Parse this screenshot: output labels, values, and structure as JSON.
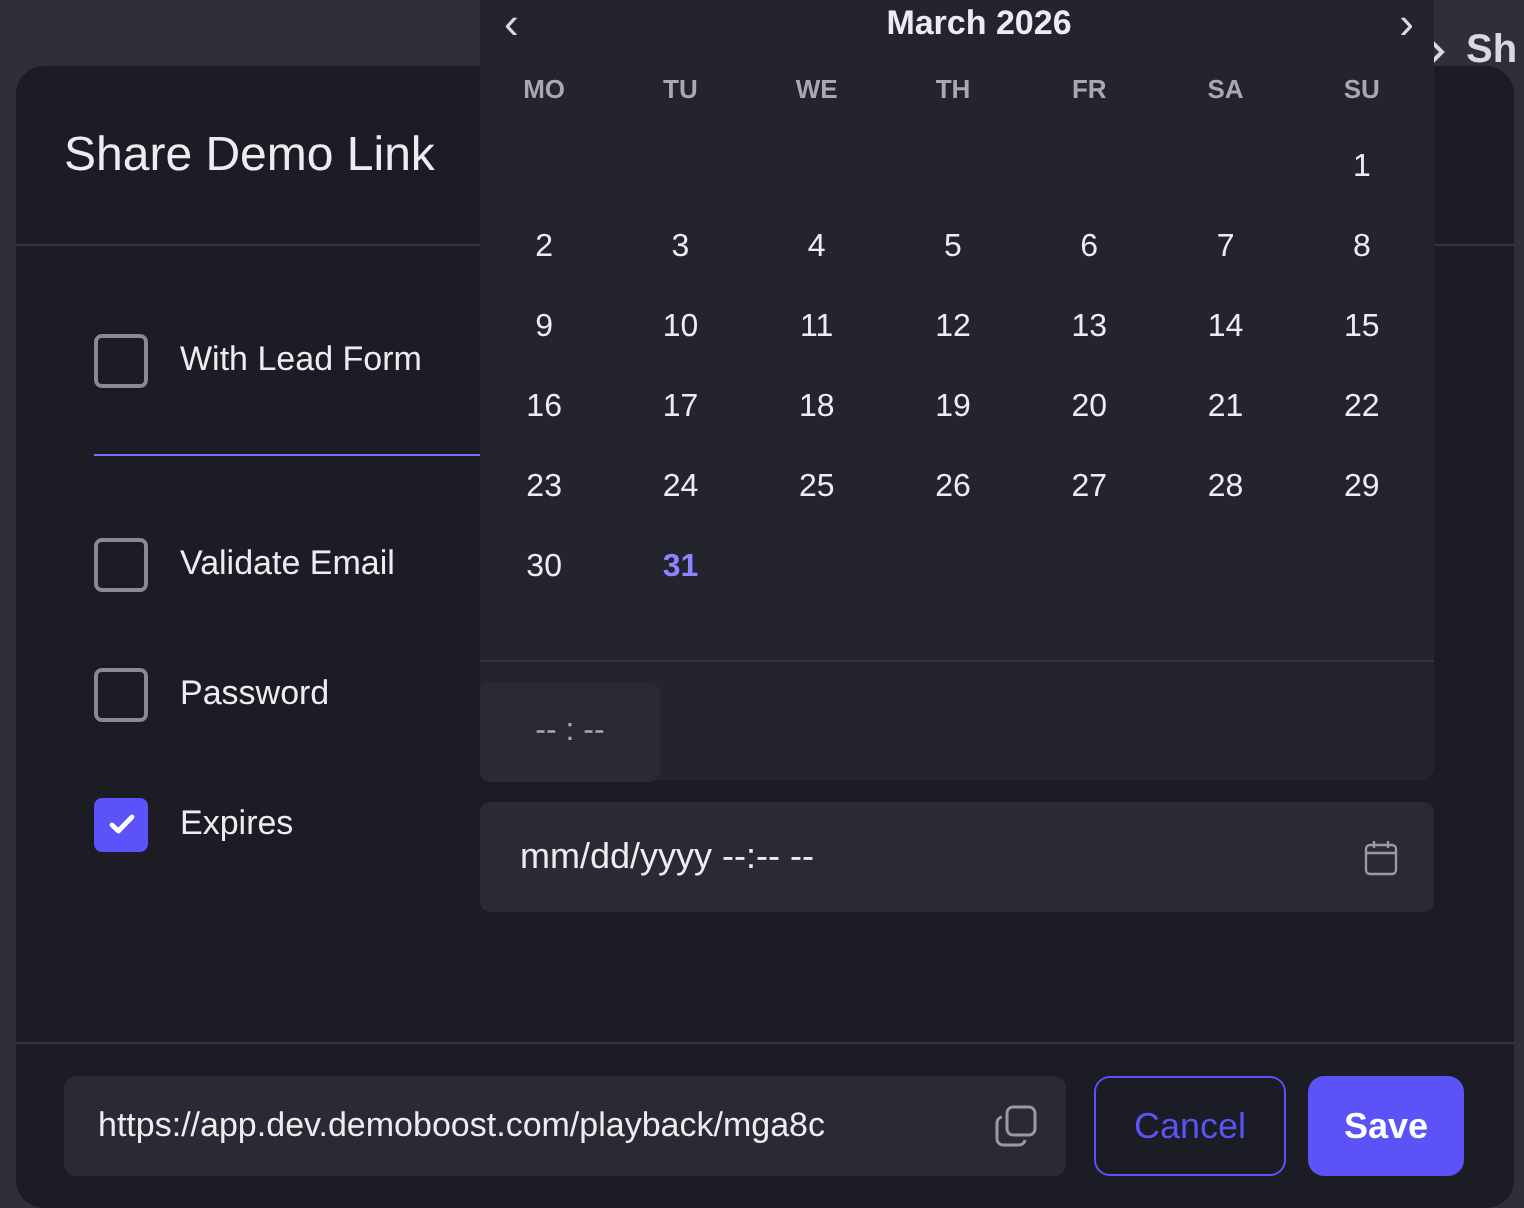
{
  "background": {
    "breadcrumb": "Sh"
  },
  "dialog": {
    "title": "Share Demo Link",
    "options": [
      {
        "label": "With Lead Form",
        "checked": false
      },
      {
        "label": "Validate Email",
        "checked": false
      },
      {
        "label": "Password",
        "checked": false
      },
      {
        "label": "Expires",
        "checked": true
      }
    ],
    "expiry_field": {
      "value": "mm/dd/yyyy --:-- --"
    },
    "link_field": {
      "value": "https://app.dev.demoboost.com/playback/mga8c"
    },
    "buttons": [
      {
        "label": "Cancel",
        "kind": "secondary"
      },
      {
        "label": "Save",
        "kind": "primary"
      }
    ]
  },
  "calendar": {
    "month": "March 2026",
    "prev": "‹",
    "next": "›",
    "weekdays": [
      "MO",
      "TU",
      "WE",
      "TH",
      "FR",
      "SA",
      "SU"
    ],
    "weeks": [
      {
        "days": [
          {
            "label": "1",
            "today": false
          }
        ]
      },
      {
        "days": [
          {
            "label": "2",
            "today": false
          },
          {
            "label": "3",
            "today": false
          },
          {
            "label": "4",
            "today": false
          },
          {
            "label": "5",
            "today": false
          },
          {
            "label": "6",
            "today": false
          },
          {
            "label": "7",
            "today": false
          },
          {
            "label": "8",
            "today": false
          }
        ]
      },
      {
        "days": [
          {
            "label": "9",
            "today": false
          },
          {
            "label": "10",
            "today": false
          },
          {
            "label": "11",
            "today": false
          },
          {
            "label": "12",
            "today": false
          },
          {
            "label": "13",
            "today": false
          },
          {
            "label": "14",
            "today": false
          },
          {
            "label": "15",
            "today": false
          }
        ]
      },
      {
        "days": [
          {
            "label": "16",
            "today": false
          },
          {
            "label": "17",
            "today": false
          },
          {
            "label": "18",
            "today": false
          },
          {
            "label": "19",
            "today": false
          },
          {
            "label": "20",
            "today": false
          },
          {
            "label": "21",
            "today": false
          },
          {
            "label": "22",
            "today": false
          }
        ]
      },
      {
        "days": [
          {
            "label": "23",
            "today": false
          },
          {
            "label": "24",
            "today": false
          },
          {
            "label": "25",
            "today": false
          },
          {
            "label": "26",
            "today": false
          },
          {
            "label": "27",
            "today": false
          },
          {
            "label": "28",
            "today": false
          },
          {
            "label": "29",
            "today": false
          }
        ]
      },
      {
        "days": [
          {
            "label": "30",
            "today": false
          },
          {
            "label": "31",
            "today": true
          }
        ]
      }
    ],
    "time": "-- : --"
  }
}
